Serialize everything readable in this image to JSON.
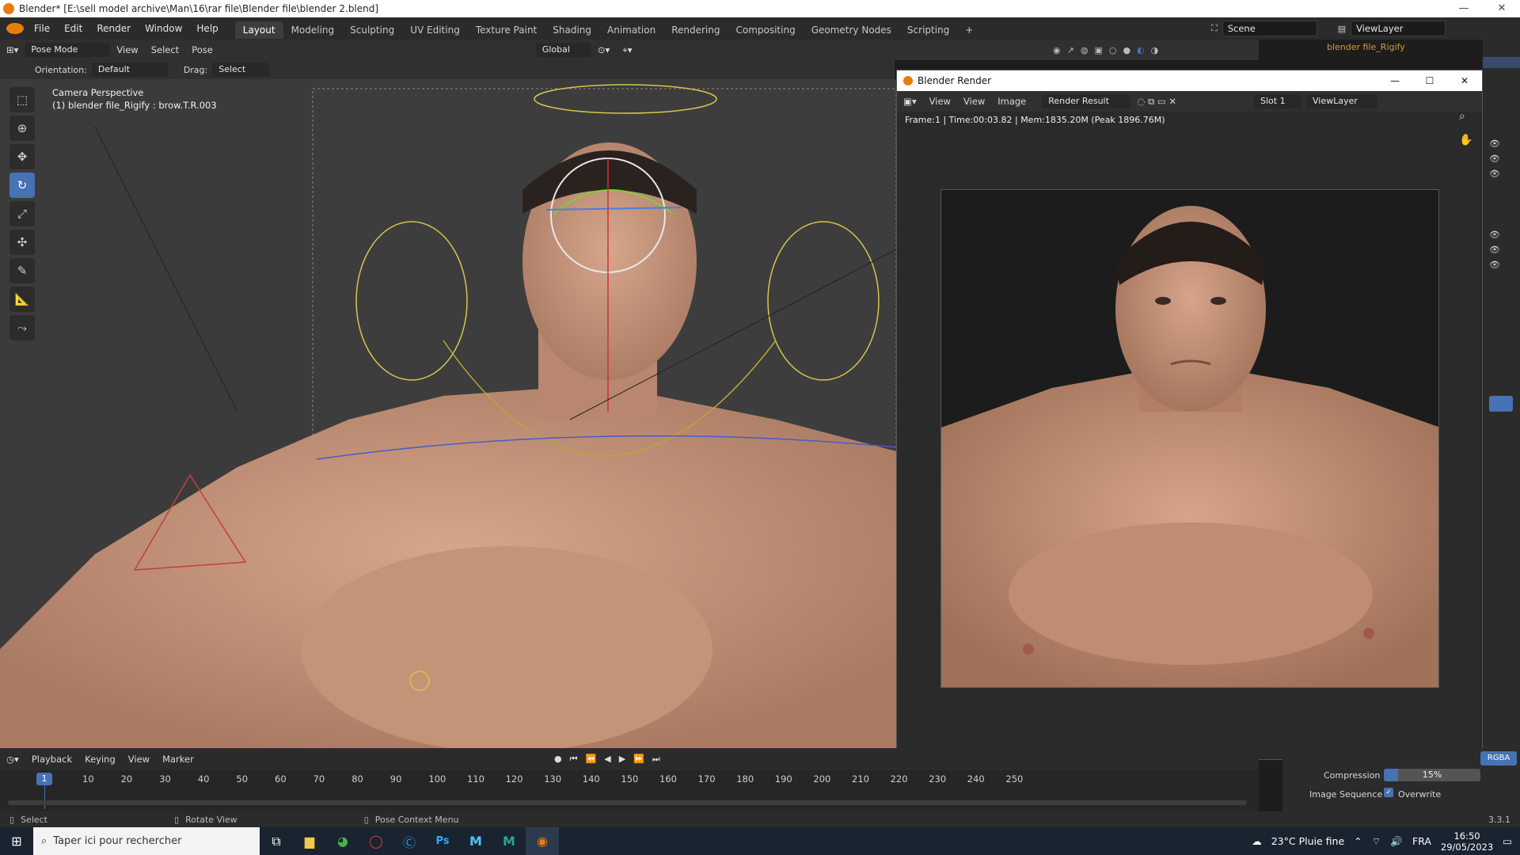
{
  "window": {
    "title": "Blender* [E:\\sell model archive\\Man\\16\\rar file\\Blender file\\blender 2.blend]",
    "minimize": "—",
    "maximize": "❐",
    "close": "✕"
  },
  "menubar": {
    "items": [
      "File",
      "Edit",
      "Render",
      "Window",
      "Help"
    ],
    "workspaces": [
      "Layout",
      "Modeling",
      "Sculpting",
      "UV Editing",
      "Texture Paint",
      "Shading",
      "Animation",
      "Rendering",
      "Compositing",
      "Geometry Nodes",
      "Scripting"
    ],
    "active_workspace": "Layout",
    "add_tab": "+",
    "scene": "Scene",
    "view_layer": "ViewLayer"
  },
  "viewport_header": {
    "mode": "Pose Mode",
    "menus": [
      "View",
      "Select",
      "Pose"
    ],
    "transform_orientation": "Global",
    "orientation_label": "Orientation:",
    "orientation_value": "Default",
    "drag_label": "Drag:",
    "drag_value": "Select Box"
  },
  "viewport": {
    "camera_label": "Camera Perspective",
    "object_label": "(1) blender file_Rigify : brow.T.R.003"
  },
  "outliner": {
    "item": "blender file_Rigify"
  },
  "render_window": {
    "title": "Blender Render",
    "menus": [
      "View",
      "View",
      "Image"
    ],
    "image_name": "Render Result",
    "slot": "Slot 1",
    "view_layer": "ViewLayer",
    "stats": "Frame:1 | Time:00:03.82 | Mem:1835.20M (Peak 1896.76M)"
  },
  "properties": {
    "compression_label": "Compression",
    "compression_value": "15%",
    "compression_fraction": 0.15,
    "image_sequence_label": "Image Sequence",
    "overwrite_label": "Overwrite",
    "overwrite_checked": true,
    "rgba_label": "RGBA"
  },
  "timeline": {
    "menus": [
      "Playback",
      "Keying",
      "View",
      "Marker"
    ],
    "current_frame": "1",
    "ticks": [
      "10",
      "20",
      "30",
      "40",
      "50",
      "60",
      "70",
      "80",
      "90",
      "100",
      "110",
      "120",
      "130",
      "140",
      "150",
      "160",
      "170",
      "180",
      "190",
      "200",
      "210",
      "220",
      "230",
      "240",
      "250"
    ]
  },
  "statusbar": {
    "select": "Select",
    "rotate": "Rotate View",
    "context": "Pose Context Menu",
    "version": "3.3.1"
  },
  "taskbar": {
    "search_placeholder": "Taper ici pour rechercher",
    "weather": "23°C  Pluie fine",
    "lang": "FRA",
    "time": "16:50",
    "date": "29/05/2023"
  },
  "colors": {
    "accent": "#4772b3",
    "blender_orange": "#e87d0d"
  }
}
